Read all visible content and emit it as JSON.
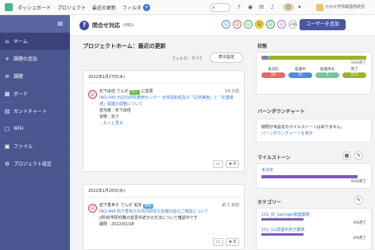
{
  "topbar": {
    "nav": [
      "ダッシュボード",
      "プロジェクト",
      "最近の更新",
      "フィルタ"
    ],
    "plus": "+",
    "search_icon": "search-icon",
    "space_name": "九州大学情報連携統括"
  },
  "sidebar": {
    "menu_icon": "≡",
    "items": [
      {
        "label": "ホーム",
        "icon": "⌂"
      },
      {
        "label": "課題の追加",
        "icon": "+"
      },
      {
        "label": "課題",
        "icon": "≡"
      },
      {
        "label": "ボード",
        "icon": "▦"
      },
      {
        "label": "ガントチャート",
        "icon": "▤"
      },
      {
        "label": "Wiki",
        "icon": "▢"
      },
      {
        "label": "ファイル",
        "icon": "▣"
      },
      {
        "label": "プロジェクト設定",
        "icon": "⚙"
      }
    ]
  },
  "header": {
    "title": "問合せ対応",
    "key": "(INQ)",
    "add_user_label": "ユーザーを追加"
  },
  "main": {
    "section_title": "プロジェクトホーム：最近の更新",
    "filter_label": "フィルタ：すべて",
    "display_button": "表示設定",
    "cards": [
      {
        "date": "2022年1月27日(木)",
        "user": "石下由佳 さんが",
        "tag": "完了",
        "action": "に変更",
        "time": "14 分前",
        "issue": "INQ-445",
        "lines": [
          "INQ-445 日記の研究費用センター 合併前助成及び「記述実施」と「比重最適」関連の調整について",
          "担当者 : 石下由佳",
          "状態 : 完了"
        ],
        "more": "…もっと見る",
        "comment_icon": "comment-icon",
        "star": "★ 0"
      },
      {
        "date": "2022年1月26日(水)",
        "user": "岩下香世子 さんが 追加",
        "tag": "更新",
        "time": "約 1 日前",
        "issue": "INQ-444",
        "lines": [
          "INQ-444 岩下香世子の共同研究の支援内容のご相談について",
          "(例)科学研究費の変更手続きの方法について確認中です",
          "期限 : 2022/01/28"
        ],
        "comment_icon": "comment-icon",
        "star": "★ 0"
      }
    ]
  },
  "right": {
    "status_title": "状態",
    "status_pct": "93%完了",
    "status_items": [
      {
        "label": "未対応",
        "count": "10",
        "color": "#e26a6a"
      },
      {
        "label": "処理中",
        "count": "15",
        "color": "#4e8bd8"
      },
      {
        "label": "処理済み",
        "count": "3",
        "color": "#79c4a1"
      },
      {
        "label": "完了",
        "count": "372",
        "color": "#a1af2f"
      }
    ],
    "burndown_title": "バーンダウンチャート",
    "burndown_text": "期限が未設定のマイルストーンはありません。",
    "burndown_link": "バーンダウンチャートを表示",
    "milestone_title": "マイルストーン",
    "milestone_name": "未決定",
    "milestone_pct": "93%完了",
    "category_title": "カテゴリー",
    "categories": [
      {
        "name": "101_科_Springer関連業務",
        "pct": "0%完了"
      },
      {
        "name": "102_ILL関連手続き業務",
        "pct": "0%完了"
      }
    ]
  },
  "colors": {
    "sidebar": "#4a5690",
    "accent": "#4a56a0",
    "link": "#3a7bd5"
  }
}
